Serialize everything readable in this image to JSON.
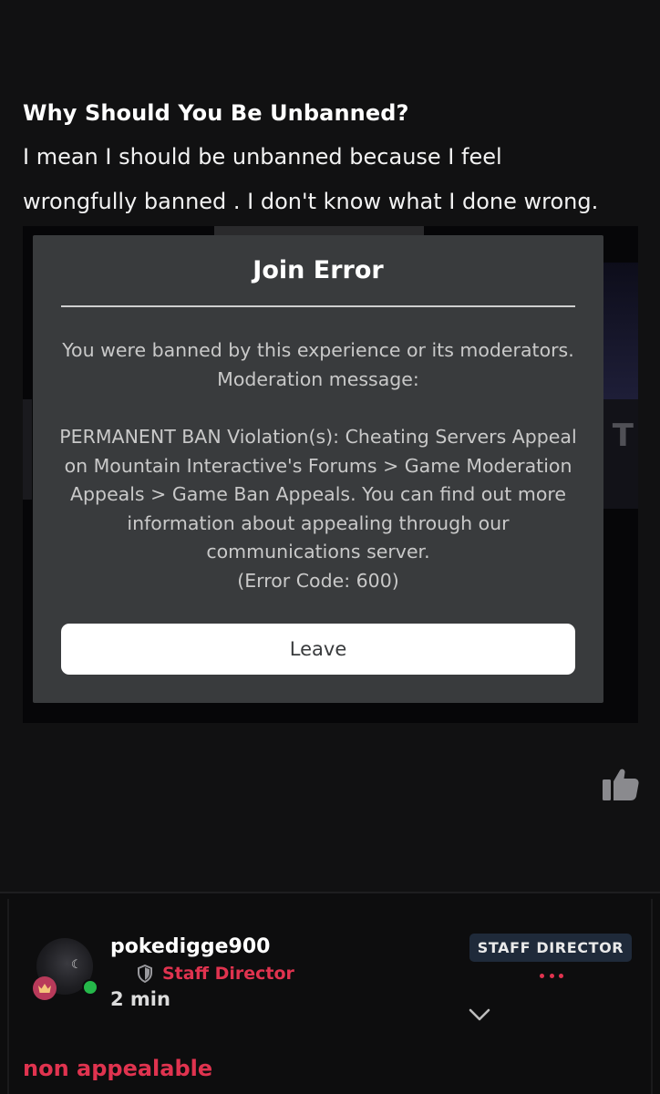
{
  "post": {
    "question_heading": "Why Should You Be Unbanned?",
    "answer_lines": [
      "I mean I should be unbanned because I feel",
      "wrongfully banned . I don't know what I done wrong."
    ]
  },
  "embedded_screenshot": {
    "background_letter": "T",
    "dialog": {
      "title": "Join Error",
      "message_intro": "You were banned by this experience or its moderators. Moderation message:",
      "message_body": "PERMANENT BAN Violation(s): Cheating Servers Appeal on Mountain Interactive's Forums > Game Moderation Appeals > Game Ban Appeals. You can find out more information about appealing through our communications server.",
      "error_code": "(Error Code: 600)",
      "button_label": "Leave"
    }
  },
  "post_actions": {
    "like_icon": "thumbs-up-icon"
  },
  "reply": {
    "username": "pokedigge900",
    "role": "Staff Director",
    "role_icon": "shield-icon",
    "time": "2 min",
    "rank_badge": "STAFF DIRECTOR",
    "online": true,
    "avatar_badge_icon": "crown-icon",
    "text": "non appealable"
  },
  "colors": {
    "background": "#111112",
    "dialog_background": "#393b3d",
    "accent_red": "#e0334f",
    "rank_badge_background": "#1f2a3a",
    "online_green": "#25b84a"
  }
}
